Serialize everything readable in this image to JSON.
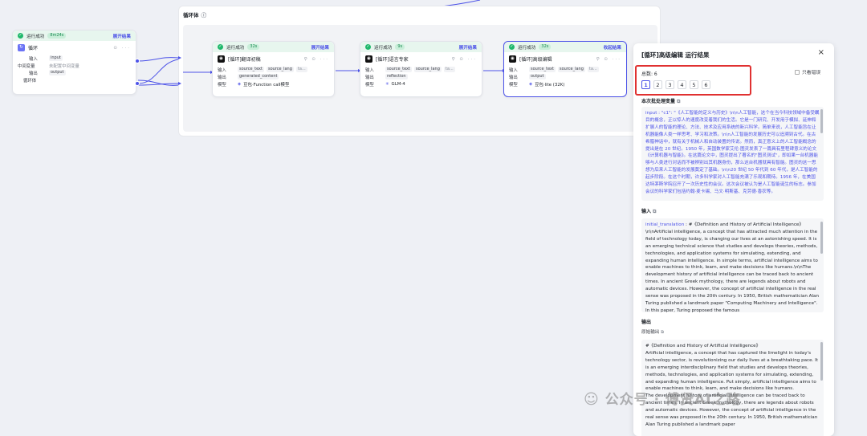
{
  "loop_node": {
    "status": "运行成功",
    "time": "8m24s",
    "expand": "展开结果",
    "title": "循环",
    "rows": [
      {
        "label": "输入",
        "tag": "input",
        "extra": ""
      },
      {
        "label": "中间变量",
        "tag": "",
        "extra": "未配置中间变量"
      },
      {
        "label": "输出",
        "tag": "output",
        "extra": ""
      },
      {
        "label": "循环体",
        "tag": "",
        "extra": ""
      }
    ]
  },
  "loop_body": {
    "title": "循环体",
    "info": "ⓘ"
  },
  "node1": {
    "status": "运行成功",
    "time": "32s",
    "expand": "展开结果",
    "title": "[循环]翻译初稿",
    "input_label": "输入",
    "inputs": [
      "source_text",
      "source_lang",
      "ta..."
    ],
    "output_label": "输出",
    "output": "generated_content",
    "model_label": "模型",
    "model": "豆包·Function call模型"
  },
  "node2": {
    "status": "运行成功",
    "time": "9s",
    "expand": "展开结果",
    "title": "[循环]语言专家",
    "input_label": "输入",
    "inputs": [
      "source_text",
      "source_lang",
      "ta..."
    ],
    "output_label": "输出",
    "output": "reflection",
    "model_label": "模型",
    "model": "GLM-4"
  },
  "node3": {
    "status": "运行成功",
    "time": "32s",
    "expand": "收起结果",
    "title": "[循环]高级编辑",
    "input_label": "输入",
    "inputs": [
      "source_text",
      "source_lang",
      "ta..."
    ],
    "output_label": "输出",
    "output": "output",
    "model_label": "模型",
    "model": "豆包·lite (32K)"
  },
  "panel": {
    "title": "[循环]高级编辑 运行结果",
    "close": "×",
    "only_errors": "只看错误",
    "total": "总数: 6",
    "pages": [
      "1",
      "2",
      "3",
      "4",
      "5",
      "6"
    ],
    "batch_title": "本次批处理变量",
    "batch_text": "input : \"c1\": \"《人工智能的定义与历史》\\n\\n人工智能，这个在当今科技领域中备受瞩目的概念，正以惊人的速度改变着我们的生活。它是一门研究、开发用于模拟、延伸和扩展人的智能的理论、方法、技术及应用系统的新兴科学。简单来说，人工智能旨在让机器能像人类一样思考、学习和决策。\\n\\n人工智能的发展历史可以追溯到古代。在古希腊神话中，就有关于机械人和自动装置的传说。然而，真正意义上的人工智能概念的提出是在 20 世纪。1950 年，英国数学家艾伦·图灵发表了一篇具有里程碑意义的论文《计算机器与智能》。在这篇论文中，图灵提出了著名的\"图灵测试\"，即如果一台机器能够与人类进行对话而不被辨别出其机器身份，那么这台机器就具有智能。图灵的这一思想为后来人工智能的发展奠定了基础。\\n\\n20 世纪 50 年代到 60 年代，是人工智能的起步阶段。在这个时期，许多科学家对人工智能充满了乐观和期待。1956 年，在美国达特茅斯学院召开了一次历史性的会议。这次会议被认为是人工智能诞生的标志。参加会议的科学家们包括约翰·麦卡锡、马文·明斯基、克劳德·香农等。",
    "input_title": "输入",
    "input_key": "initial_translation",
    "input_text": " : #《Definition and History of Artificial Intelligence》\\n\\nArtificial intelligence, a concept that has attracted much attention in the field of technology today, is changing our lives at an astonishing speed. It is an emerging technical science that studies and develops theories, methods, technologies, and application systems for simulating, extending, and expanding human intelligence. In simple terms, artificial intelligence aims to enable machines to think, learn, and make decisions like humans.\\n\\nThe development history of artificial intelligence can be traced back to ancient times. In ancient Greek mythology, there are legends about robots and automatic devices. However, the concept of artificial intelligence in the real sense was proposed in the 20th century. In 1950, British mathematician Alan Turing published a landmark paper \"Computing Machinery and Intelligence\". In this paper, Turing proposed the famous",
    "output_title": "输出",
    "raw_output_label": "原始输出",
    "raw_output_text": "#《Definition and History of Artificial Intelligence》\nArtificial intelligence, a concept that has captured the limelight in today's technology sector, is revolutionizing our daily lives at a breathtaking pace. It is an emerging interdisciplinary field that studies and develops theories, methods, technologies, and application systems for simulating, extending, and expanding human intelligence. Put simply, artificial intelligence aims to enable machines to think, learn, and make decisions like humans.\nThe development history of artificial intelligence can be traced back to ancient times. In ancient Greek mythology, there are legends about robots and automatic devices. However, the concept of artificial intelligence in the real sense was proposed in the 20th century. In 1950, British mathematician Alan Turing published a landmark paper"
  },
  "watermark": "公众号 · 傅贤AI之路",
  "colors": {
    "accent": "#4d53e8",
    "success": "#1fb86b",
    "highlight": "#e03131"
  }
}
